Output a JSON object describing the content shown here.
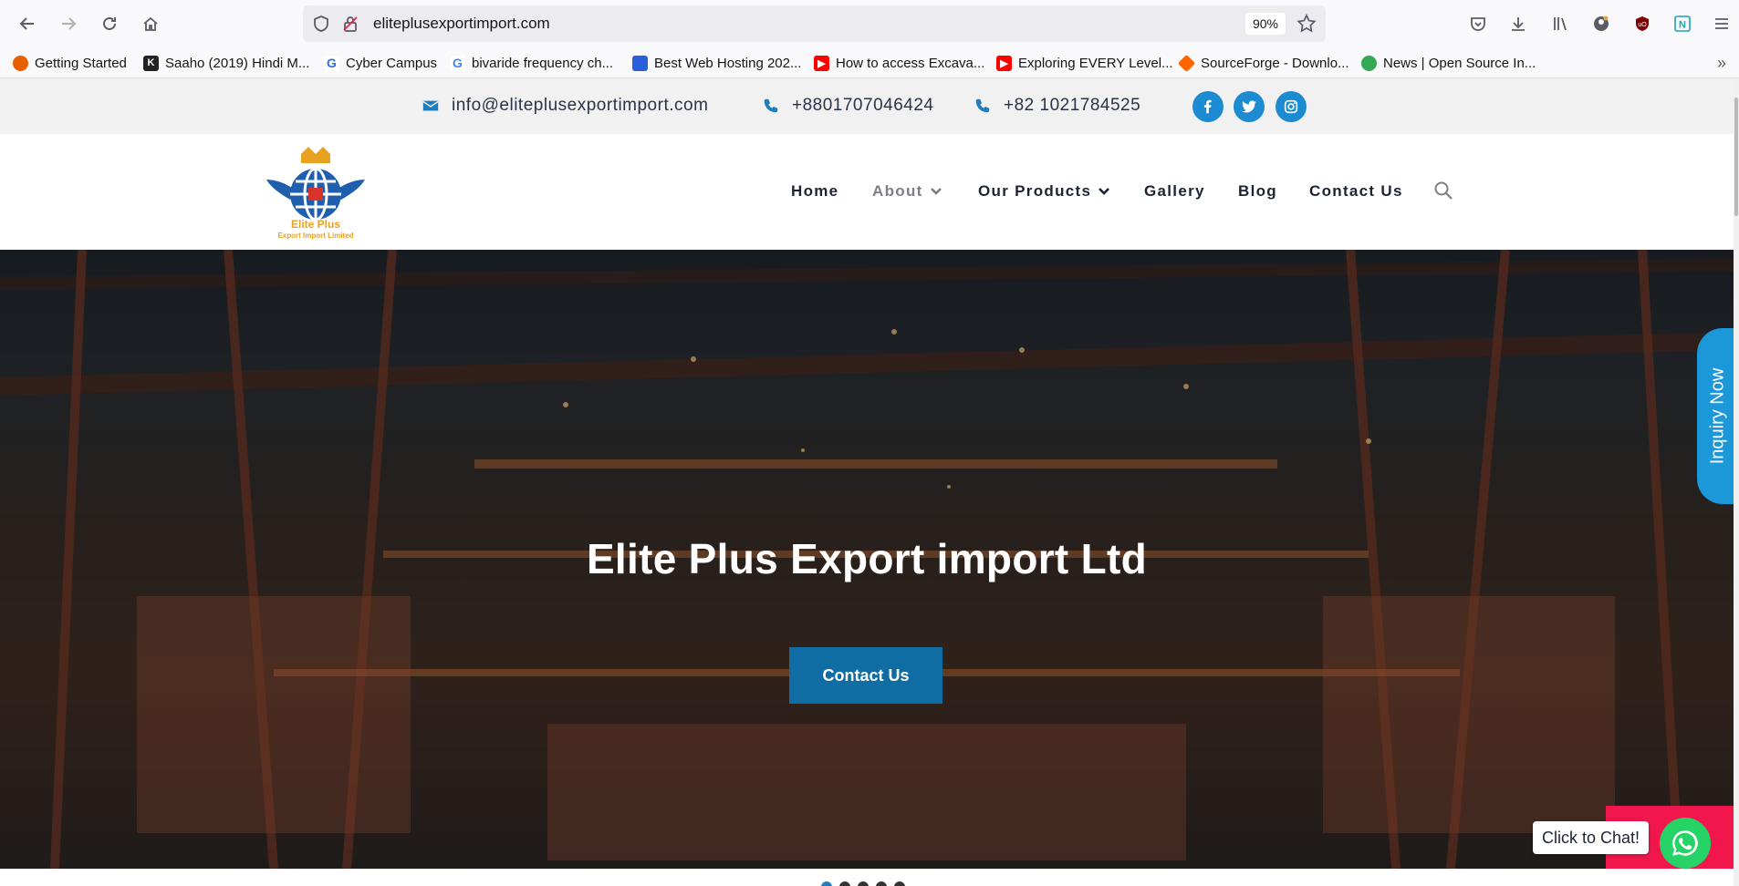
{
  "browser": {
    "url": "eliteplusexportimport.com",
    "zoom": "90%",
    "bookmarks": [
      {
        "label": "Getting Started",
        "color": "#e66000"
      },
      {
        "label": "Saaho (2019) Hindi M...",
        "color": "#222222"
      },
      {
        "label": "Cyber Campus",
        "color": "#2f6fd6"
      },
      {
        "label": "bivaride frequency ch...",
        "color": "#4285f4"
      },
      {
        "label": "Best Web Hosting 202...",
        "color": "#2b5fd9"
      },
      {
        "label": "How to access Excava...",
        "color": "#ff0000"
      },
      {
        "label": "Exploring EVERY Level...",
        "color": "#ff0000"
      },
      {
        "label": "SourceForge - Downlo...",
        "color": "#ff6600"
      },
      {
        "label": "News | Open Source In...",
        "color": "#34a853"
      }
    ]
  },
  "topbar": {
    "email": "info@eliteplusexportimport.com",
    "phone1": "+8801707046424",
    "phone2": "+82 1021784525",
    "social": [
      "facebook-icon",
      "twitter-icon",
      "instagram-icon"
    ]
  },
  "header": {
    "logo_line1": "Elite Plus",
    "logo_line2": "Export Import Limited",
    "nav": {
      "home": "Home",
      "about": "About",
      "products": "Our Products",
      "gallery": "Gallery",
      "blog": "Blog",
      "contact": "Contact Us"
    }
  },
  "hero": {
    "title": "Elite Plus Export import Ltd",
    "button": "Contact Us",
    "slides": 5,
    "active_slide": 1
  },
  "widgets": {
    "inquiry": "Inquiry Now",
    "chat": "Click to Chat!"
  },
  "colors": {
    "accent": "#1f7dbf",
    "button": "#0f6da3",
    "chat": "#25d366"
  }
}
